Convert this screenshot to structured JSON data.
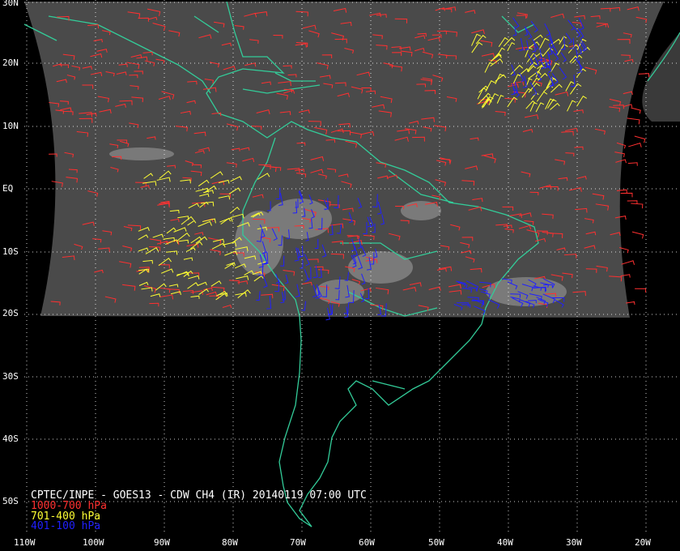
{
  "title": "CPTEC/INPE - GOES13 - CDW CH4 (IR) 20140119 07:00 UTC",
  "legend": [
    {
      "label": "1000-700 hPa",
      "color": "#ff3030"
    },
    {
      "label": "701-400 hPa",
      "color": "#ffff33"
    },
    {
      "label": "401-100 hPa",
      "color": "#2020ff"
    }
  ],
  "lat_labels": [
    "30N",
    "20N",
    "10N",
    "EQ",
    "10S",
    "20S",
    "30S",
    "40S",
    "50S"
  ],
  "lon_labels": [
    "110W",
    "100W",
    "90W",
    "80W",
    "70W",
    "60W",
    "50W",
    "40W",
    "30W",
    "20W"
  ],
  "colors": {
    "background": "#000000",
    "coastline": "#33cc99",
    "grid": "#ffffff",
    "cloud_image": "#505050"
  }
}
